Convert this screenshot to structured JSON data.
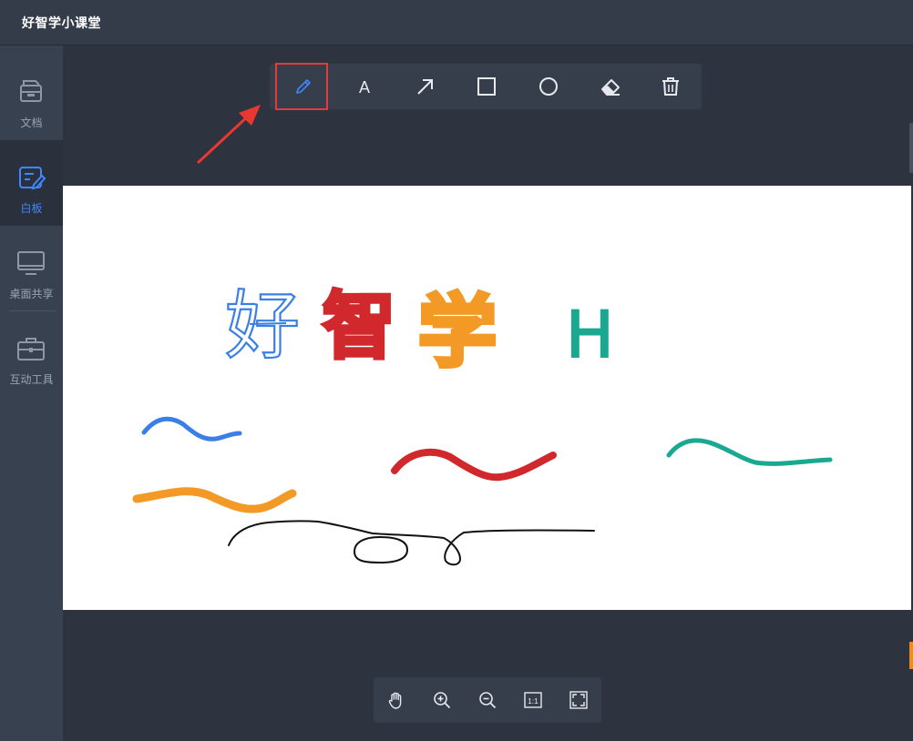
{
  "app": {
    "title": "好智学小课堂"
  },
  "sidebar": {
    "items": [
      {
        "label": "文档",
        "icon": "document-icon",
        "active": false
      },
      {
        "label": "白板",
        "icon": "whiteboard-icon",
        "active": true
      },
      {
        "label": "桌面共享",
        "icon": "monitor-icon",
        "active": false
      },
      {
        "label": "互动工具",
        "icon": "toolbox-icon",
        "active": false
      }
    ]
  },
  "toolbar": {
    "tools": [
      {
        "name": "pen",
        "icon": "pen-icon",
        "selected": true
      },
      {
        "name": "text",
        "icon": "text-icon",
        "glyph": "A"
      },
      {
        "name": "arrow",
        "icon": "arrow-icon"
      },
      {
        "name": "rectangle",
        "icon": "rectangle-icon"
      },
      {
        "name": "circle",
        "icon": "circle-icon"
      },
      {
        "name": "eraser",
        "icon": "eraser-icon"
      },
      {
        "name": "delete",
        "icon": "trash-icon"
      }
    ],
    "highlight_color": "#e23b3b"
  },
  "whiteboard": {
    "background": "#ffffff",
    "drawn_text": [
      "好",
      "智",
      "学",
      "H"
    ],
    "stroke_colors": {
      "blue": "#3a7fe6",
      "red": "#d0282c",
      "orange": "#f39a26",
      "teal": "#1aa890",
      "black": "#111111"
    }
  },
  "zoom": {
    "controls": [
      {
        "name": "pan",
        "icon": "hand-icon"
      },
      {
        "name": "zoom-in",
        "icon": "zoom-in-icon"
      },
      {
        "name": "zoom-out",
        "icon": "zoom-out-icon"
      },
      {
        "name": "actual-size",
        "icon": "actual-size-icon",
        "label": "1:1"
      },
      {
        "name": "fit-screen",
        "icon": "fit-screen-icon"
      }
    ]
  },
  "colors": {
    "accent": "#3f86ff",
    "background": "#2d3440",
    "sidebar": "#384150"
  }
}
